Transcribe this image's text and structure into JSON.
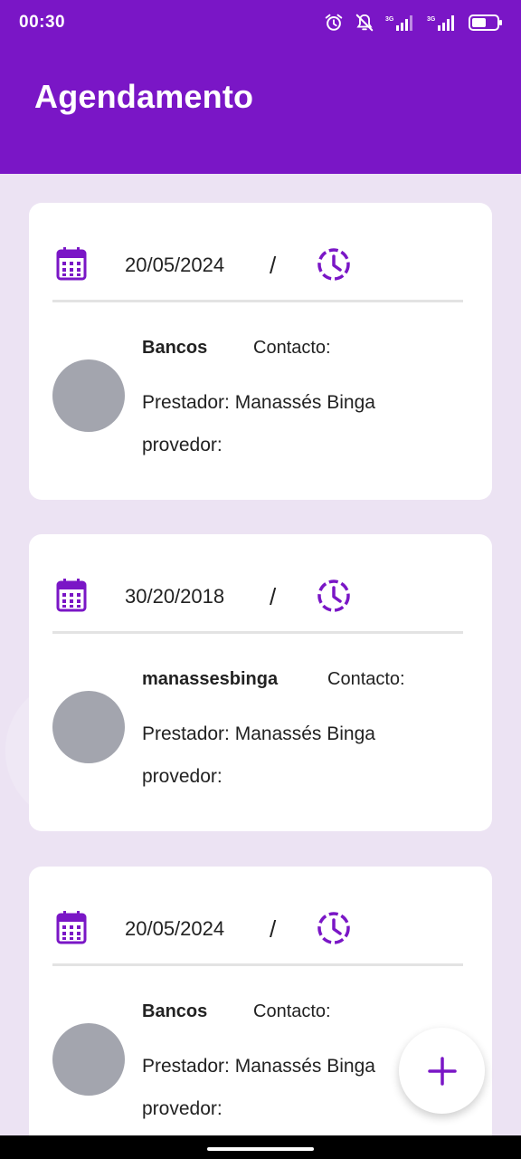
{
  "status_bar": {
    "time": "00:30",
    "icons": [
      "alarm-icon",
      "notifications-off-icon",
      "signal-3g-icon",
      "signal-3g-icon",
      "battery-icon"
    ],
    "network_label": "3G"
  },
  "header": {
    "title": "Agendamento"
  },
  "cards": [
    {
      "date": "20/05/2024",
      "separator": "/",
      "name": "Bancos",
      "contact_label": "Contacto:",
      "provider": "Prestador: Manassés Binga",
      "provedor_label": "provedor:"
    },
    {
      "date": "30/20/2018",
      "separator": "/",
      "name": "manassesbinga",
      "contact_label": "Contacto:",
      "provider": "Prestador: Manassés Binga",
      "provedor_label": "provedor:"
    },
    {
      "date": "20/05/2024",
      "separator": "/",
      "name": "Bancos",
      "contact_label": "Contacto:",
      "provider": "Prestador: Manassés Binga",
      "provedor_label": "provedor:"
    }
  ],
  "fab": {
    "icon": "plus-icon"
  },
  "colors": {
    "primary": "#7a16c6",
    "background": "#ece3f3",
    "avatar": "#a3a5ae",
    "card": "#ffffff"
  }
}
